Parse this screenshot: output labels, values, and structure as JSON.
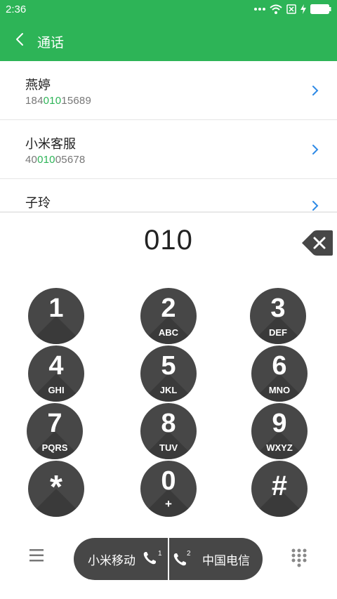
{
  "status_bar": {
    "time": "2:36",
    "icons": [
      "more-dots-icon",
      "wifi-icon",
      "no-sim-icon",
      "charging-icon",
      "battery-icon"
    ]
  },
  "app_bar": {
    "title": "通话",
    "back_icon": "back-arrow-icon"
  },
  "contacts": [
    {
      "name": "燕婷",
      "number_prefix": "184",
      "number_match": "010",
      "number_suffix": "15689"
    },
    {
      "name": "小米客服",
      "number_prefix": "40",
      "number_match": "010",
      "number_suffix": "05678"
    },
    {
      "name": "子玲",
      "number_prefix": "",
      "number_match": "",
      "number_suffix": ""
    }
  ],
  "dialer": {
    "input_value": "010"
  },
  "keypad": [
    {
      "digit": "1",
      "letters": ""
    },
    {
      "digit": "2",
      "letters": "ABC"
    },
    {
      "digit": "3",
      "letters": "DEF"
    },
    {
      "digit": "4",
      "letters": "GHI"
    },
    {
      "digit": "5",
      "letters": "JKL"
    },
    {
      "digit": "6",
      "letters": "MNO"
    },
    {
      "digit": "7",
      "letters": "PQRS"
    },
    {
      "digit": "8",
      "letters": "TUV"
    },
    {
      "digit": "9",
      "letters": "WXYZ"
    },
    {
      "digit": "*",
      "letters": ""
    },
    {
      "digit": "0",
      "letters": "+"
    },
    {
      "digit": "#",
      "letters": ""
    }
  ],
  "bottom_bar": {
    "sim1_label": "小米移动",
    "sim1_number": "1",
    "sim2_label": "中国电信",
    "sim2_number": "2"
  },
  "colors": {
    "accent": "#2db457",
    "key_bg": "#474747",
    "link_arrow": "#2e8ae6"
  }
}
